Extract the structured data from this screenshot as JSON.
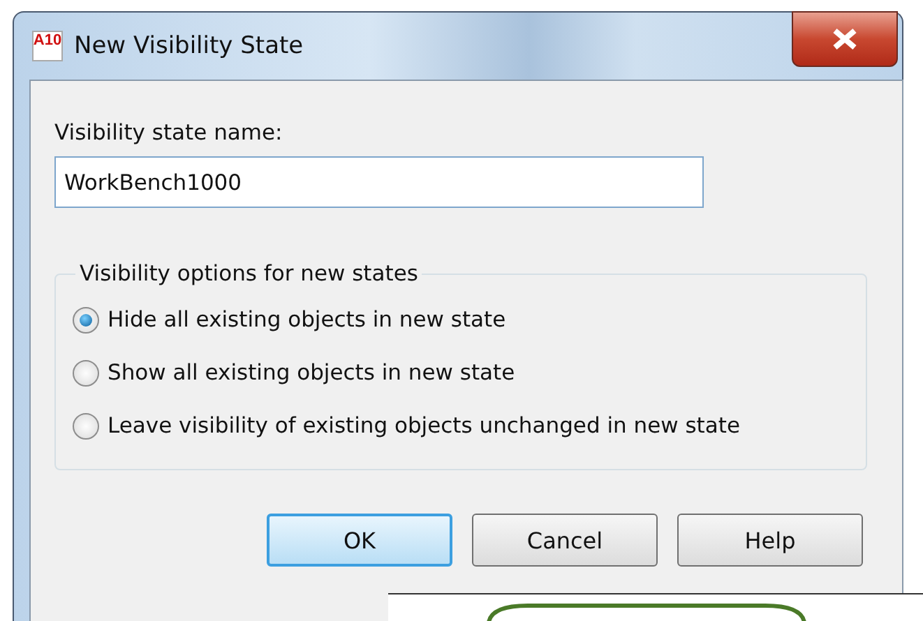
{
  "window": {
    "title": "New Visibility State",
    "app_icon_text": "A10"
  },
  "name_label": "Visibility state name:",
  "name_field": {
    "value": "WorkBench1000"
  },
  "options": {
    "legend": "Visibility options for new states",
    "items": [
      {
        "label": "Hide all existing objects in new state",
        "selected": true
      },
      {
        "label": "Show all existing objects in new state",
        "selected": false
      },
      {
        "label": "Leave visibility of existing objects unchanged in new state",
        "selected": false
      }
    ]
  },
  "buttons": [
    {
      "label": "OK",
      "default": true
    },
    {
      "label": "Cancel",
      "default": false
    },
    {
      "label": "Help",
      "default": false
    }
  ]
}
